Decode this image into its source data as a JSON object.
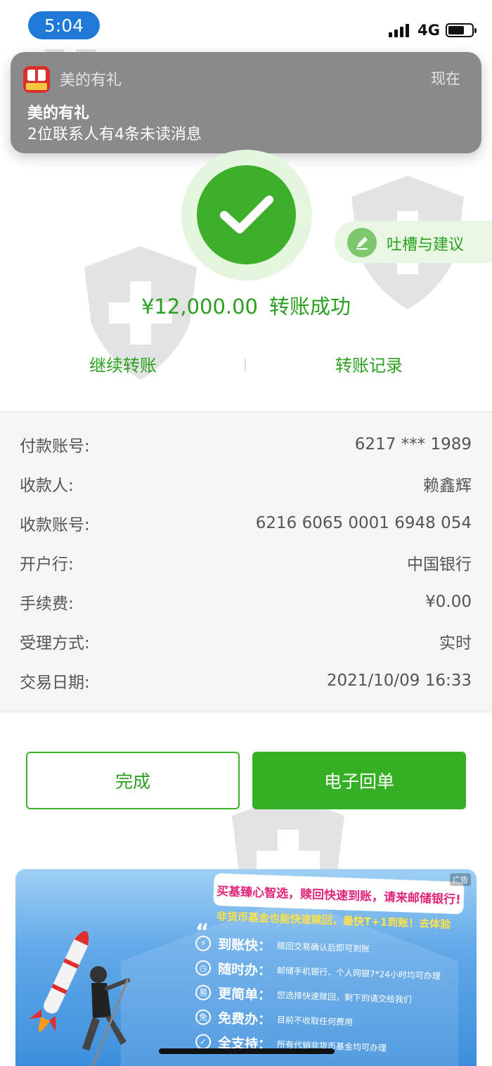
{
  "status_bar": {
    "time": "5:04",
    "network": "4G"
  },
  "notification": {
    "app_name": "美的有礼",
    "time": "现在",
    "title": "美的有礼",
    "body": "2位联系人有4条未读消息",
    "icon": "gift-app-icon"
  },
  "result": {
    "icon": "checkmark-icon",
    "amount": "¥12,000.00",
    "status": "转账成功",
    "accent_color": "#3daf2b"
  },
  "feedback": {
    "label": "吐槽与建议",
    "icon": "pencil-icon"
  },
  "actions": {
    "continue": "继续转账",
    "records": "转账记录"
  },
  "details": [
    {
      "label": "付款账号:",
      "value": "6217 *** 1989"
    },
    {
      "label": "收款人:",
      "value": "赖鑫辉"
    },
    {
      "label": "收款账号:",
      "value": "6216 6065 0001 6948 054"
    },
    {
      "label": "开户行:",
      "value": "中国银行"
    },
    {
      "label": "手续费:",
      "value": "¥0.00"
    },
    {
      "label": "受理方式:",
      "value": "实时"
    },
    {
      "label": "交易日期:",
      "value": "2021/10/09 16:33"
    }
  ],
  "buttons": {
    "done": "完成",
    "receipt": "电子回单"
  },
  "ad": {
    "tag": "广告",
    "headline": "买基臻心智选，赎回快速到账，请来邮储银行!",
    "sub": "非货币基金也能快速赎回，最快T+1到账！去体验",
    "features": [
      {
        "icon": "⚡",
        "title": "到账快：",
        "desc": "赎回交易确认后即可到账"
      },
      {
        "icon": "◷",
        "title": "随时办：",
        "desc": "邮储手机银行、个人网银7*24小时均可办理"
      },
      {
        "icon": "易",
        "title": "更简单：",
        "desc": "您选择快速赎回，剩下的请交给我们"
      },
      {
        "icon": "免",
        "title": "免费办：",
        "desc": "目前不收取任何费用"
      },
      {
        "icon": "✓",
        "title": "全支持：",
        "desc": "所有代销非货币基金均可办理"
      }
    ]
  }
}
